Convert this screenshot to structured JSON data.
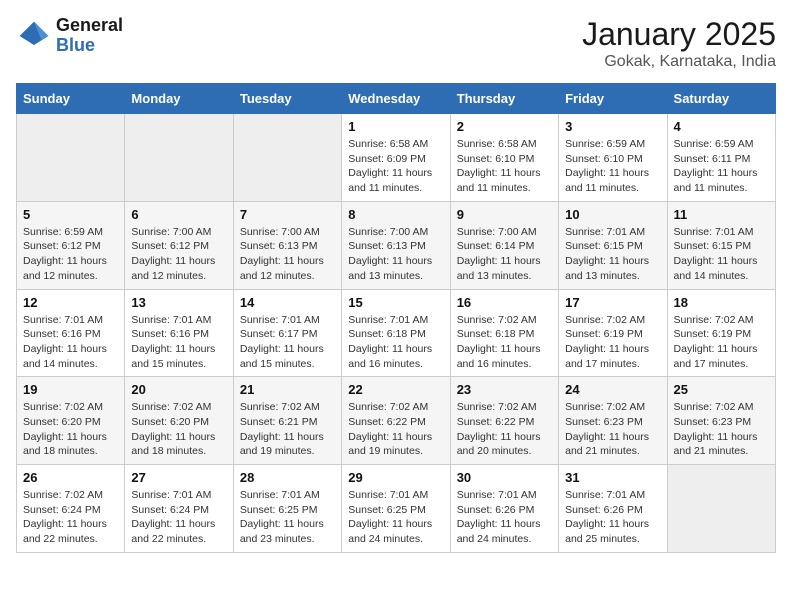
{
  "header": {
    "logo_general": "General",
    "logo_blue": "Blue",
    "month_title": "January 2025",
    "location": "Gokak, Karnataka, India"
  },
  "days_of_week": [
    "Sunday",
    "Monday",
    "Tuesday",
    "Wednesday",
    "Thursday",
    "Friday",
    "Saturday"
  ],
  "weeks": [
    [
      {
        "day": "",
        "sunrise": "",
        "sunset": "",
        "daylight": ""
      },
      {
        "day": "",
        "sunrise": "",
        "sunset": "",
        "daylight": ""
      },
      {
        "day": "",
        "sunrise": "",
        "sunset": "",
        "daylight": ""
      },
      {
        "day": "1",
        "sunrise": "Sunrise: 6:58 AM",
        "sunset": "Sunset: 6:09 PM",
        "daylight": "Daylight: 11 hours and 11 minutes."
      },
      {
        "day": "2",
        "sunrise": "Sunrise: 6:58 AM",
        "sunset": "Sunset: 6:10 PM",
        "daylight": "Daylight: 11 hours and 11 minutes."
      },
      {
        "day": "3",
        "sunrise": "Sunrise: 6:59 AM",
        "sunset": "Sunset: 6:10 PM",
        "daylight": "Daylight: 11 hours and 11 minutes."
      },
      {
        "day": "4",
        "sunrise": "Sunrise: 6:59 AM",
        "sunset": "Sunset: 6:11 PM",
        "daylight": "Daylight: 11 hours and 11 minutes."
      }
    ],
    [
      {
        "day": "5",
        "sunrise": "Sunrise: 6:59 AM",
        "sunset": "Sunset: 6:12 PM",
        "daylight": "Daylight: 11 hours and 12 minutes."
      },
      {
        "day": "6",
        "sunrise": "Sunrise: 7:00 AM",
        "sunset": "Sunset: 6:12 PM",
        "daylight": "Daylight: 11 hours and 12 minutes."
      },
      {
        "day": "7",
        "sunrise": "Sunrise: 7:00 AM",
        "sunset": "Sunset: 6:13 PM",
        "daylight": "Daylight: 11 hours and 12 minutes."
      },
      {
        "day": "8",
        "sunrise": "Sunrise: 7:00 AM",
        "sunset": "Sunset: 6:13 PM",
        "daylight": "Daylight: 11 hours and 13 minutes."
      },
      {
        "day": "9",
        "sunrise": "Sunrise: 7:00 AM",
        "sunset": "Sunset: 6:14 PM",
        "daylight": "Daylight: 11 hours and 13 minutes."
      },
      {
        "day": "10",
        "sunrise": "Sunrise: 7:01 AM",
        "sunset": "Sunset: 6:15 PM",
        "daylight": "Daylight: 11 hours and 13 minutes."
      },
      {
        "day": "11",
        "sunrise": "Sunrise: 7:01 AM",
        "sunset": "Sunset: 6:15 PM",
        "daylight": "Daylight: 11 hours and 14 minutes."
      }
    ],
    [
      {
        "day": "12",
        "sunrise": "Sunrise: 7:01 AM",
        "sunset": "Sunset: 6:16 PM",
        "daylight": "Daylight: 11 hours and 14 minutes."
      },
      {
        "day": "13",
        "sunrise": "Sunrise: 7:01 AM",
        "sunset": "Sunset: 6:16 PM",
        "daylight": "Daylight: 11 hours and 15 minutes."
      },
      {
        "day": "14",
        "sunrise": "Sunrise: 7:01 AM",
        "sunset": "Sunset: 6:17 PM",
        "daylight": "Daylight: 11 hours and 15 minutes."
      },
      {
        "day": "15",
        "sunrise": "Sunrise: 7:01 AM",
        "sunset": "Sunset: 6:18 PM",
        "daylight": "Daylight: 11 hours and 16 minutes."
      },
      {
        "day": "16",
        "sunrise": "Sunrise: 7:02 AM",
        "sunset": "Sunset: 6:18 PM",
        "daylight": "Daylight: 11 hours and 16 minutes."
      },
      {
        "day": "17",
        "sunrise": "Sunrise: 7:02 AM",
        "sunset": "Sunset: 6:19 PM",
        "daylight": "Daylight: 11 hours and 17 minutes."
      },
      {
        "day": "18",
        "sunrise": "Sunrise: 7:02 AM",
        "sunset": "Sunset: 6:19 PM",
        "daylight": "Daylight: 11 hours and 17 minutes."
      }
    ],
    [
      {
        "day": "19",
        "sunrise": "Sunrise: 7:02 AM",
        "sunset": "Sunset: 6:20 PM",
        "daylight": "Daylight: 11 hours and 18 minutes."
      },
      {
        "day": "20",
        "sunrise": "Sunrise: 7:02 AM",
        "sunset": "Sunset: 6:20 PM",
        "daylight": "Daylight: 11 hours and 18 minutes."
      },
      {
        "day": "21",
        "sunrise": "Sunrise: 7:02 AM",
        "sunset": "Sunset: 6:21 PM",
        "daylight": "Daylight: 11 hours and 19 minutes."
      },
      {
        "day": "22",
        "sunrise": "Sunrise: 7:02 AM",
        "sunset": "Sunset: 6:22 PM",
        "daylight": "Daylight: 11 hours and 19 minutes."
      },
      {
        "day": "23",
        "sunrise": "Sunrise: 7:02 AM",
        "sunset": "Sunset: 6:22 PM",
        "daylight": "Daylight: 11 hours and 20 minutes."
      },
      {
        "day": "24",
        "sunrise": "Sunrise: 7:02 AM",
        "sunset": "Sunset: 6:23 PM",
        "daylight": "Daylight: 11 hours and 21 minutes."
      },
      {
        "day": "25",
        "sunrise": "Sunrise: 7:02 AM",
        "sunset": "Sunset: 6:23 PM",
        "daylight": "Daylight: 11 hours and 21 minutes."
      }
    ],
    [
      {
        "day": "26",
        "sunrise": "Sunrise: 7:02 AM",
        "sunset": "Sunset: 6:24 PM",
        "daylight": "Daylight: 11 hours and 22 minutes."
      },
      {
        "day": "27",
        "sunrise": "Sunrise: 7:01 AM",
        "sunset": "Sunset: 6:24 PM",
        "daylight": "Daylight: 11 hours and 22 minutes."
      },
      {
        "day": "28",
        "sunrise": "Sunrise: 7:01 AM",
        "sunset": "Sunset: 6:25 PM",
        "daylight": "Daylight: 11 hours and 23 minutes."
      },
      {
        "day": "29",
        "sunrise": "Sunrise: 7:01 AM",
        "sunset": "Sunset: 6:25 PM",
        "daylight": "Daylight: 11 hours and 24 minutes."
      },
      {
        "day": "30",
        "sunrise": "Sunrise: 7:01 AM",
        "sunset": "Sunset: 6:26 PM",
        "daylight": "Daylight: 11 hours and 24 minutes."
      },
      {
        "day": "31",
        "sunrise": "Sunrise: 7:01 AM",
        "sunset": "Sunset: 6:26 PM",
        "daylight": "Daylight: 11 hours and 25 minutes."
      },
      {
        "day": "",
        "sunrise": "",
        "sunset": "",
        "daylight": ""
      }
    ]
  ]
}
